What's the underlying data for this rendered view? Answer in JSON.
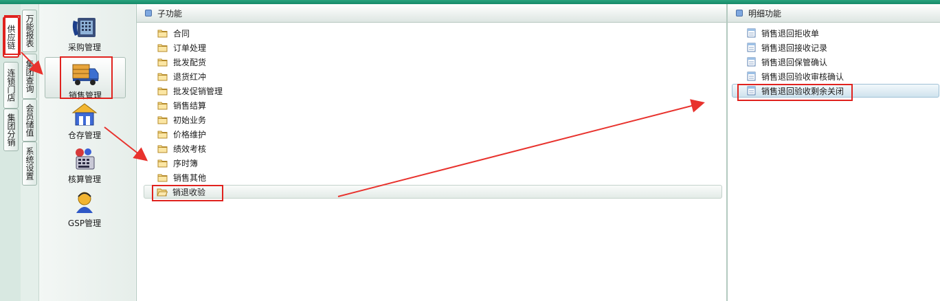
{
  "left_tabs": [
    {
      "label": "供应链",
      "active": true
    },
    {
      "label": "连锁门店",
      "active": false
    },
    {
      "label": "集团分销",
      "active": false
    }
  ],
  "second_tabs": [
    {
      "label": "万能报表"
    },
    {
      "label": "集团查询"
    },
    {
      "label": "会员储值"
    },
    {
      "label": "系统设置"
    }
  ],
  "modules": [
    {
      "label": "采购管理",
      "icon": "purchase-icon"
    },
    {
      "label": "销售管理",
      "icon": "delivery-truck-icon",
      "selected": true
    },
    {
      "label": "仓存管理",
      "icon": "warehouse-icon"
    },
    {
      "label": "核算管理",
      "icon": "accounting-icon"
    },
    {
      "label": "GSP管理",
      "icon": "gsp-person-icon"
    }
  ],
  "sub_panel": {
    "title": "子功能",
    "items": [
      {
        "label": "合同"
      },
      {
        "label": "订单处理"
      },
      {
        "label": "批发配货"
      },
      {
        "label": "退货红冲"
      },
      {
        "label": "批发促销管理"
      },
      {
        "label": "销售结算"
      },
      {
        "label": "初始业务"
      },
      {
        "label": "价格维护"
      },
      {
        "label": "绩效考核"
      },
      {
        "label": "序时簿"
      },
      {
        "label": "销售其他"
      },
      {
        "label": "销退收验",
        "selected": true
      }
    ]
  },
  "detail_panel": {
    "title": "明细功能",
    "items": [
      {
        "label": "销售退回拒收单"
      },
      {
        "label": "销售退回接收记录"
      },
      {
        "label": "销售退回保管确认"
      },
      {
        "label": "销售退回验收审核确认"
      },
      {
        "label": "销售退回验收剩余关闭",
        "selected": true
      }
    ]
  },
  "colors": {
    "highlight": "#e0221e",
    "brand": "#1f9a74"
  }
}
